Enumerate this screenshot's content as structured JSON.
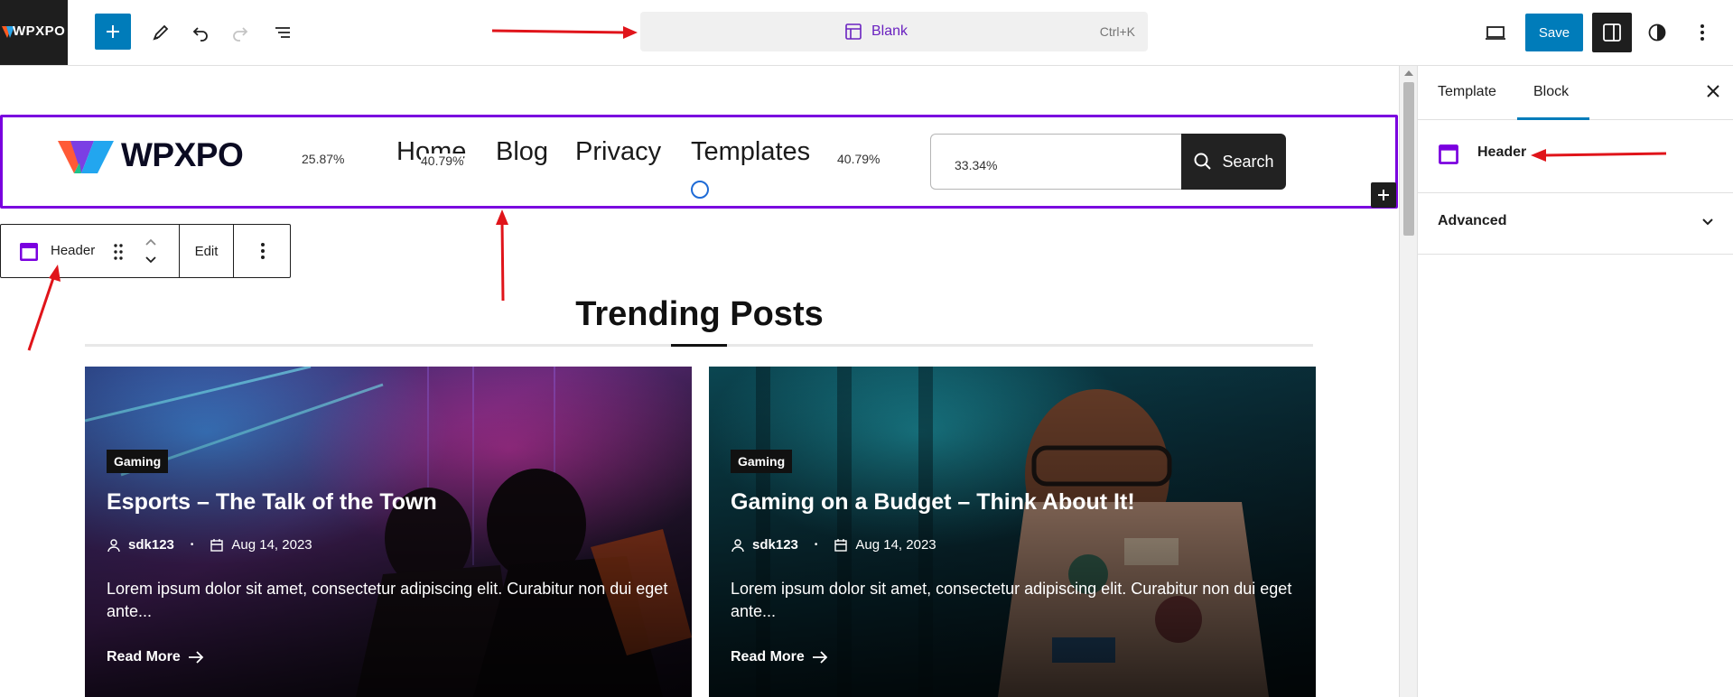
{
  "app": {
    "logo_text": "WPXPO"
  },
  "toolbar": {
    "document_title": "Blank",
    "shortcut": "Ctrl+K",
    "save_label": "Save"
  },
  "header_block": {
    "site_name": "WPXPO",
    "nav_items": [
      "Home",
      "Blog",
      "Privacy",
      "Templates"
    ],
    "width_labels": [
      "25.87%",
      "40.79%",
      "40.79%",
      "33.34%"
    ],
    "search_label": "Search"
  },
  "block_toolbar": {
    "block_name": "Header",
    "edit_label": "Edit"
  },
  "section": {
    "title": "Trending Posts"
  },
  "posts": [
    {
      "category": "Gaming",
      "title": "Esports – The Talk of the Town",
      "author": "sdk123",
      "date": "Aug 14, 2023",
      "excerpt": "Lorem ipsum dolor sit amet, consectetur adipiscing elit. Curabitur non dui eget ante...",
      "read_more": "Read More"
    },
    {
      "category": "Gaming",
      "title": "Gaming on a Budget – Think About It!",
      "author": "sdk123",
      "date": "Aug 14, 2023",
      "excerpt": "Lorem ipsum dolor sit amet, consectetur adipiscing elit. Curabitur non dui eget ante...",
      "read_more": "Read More"
    }
  ],
  "sidebar": {
    "tabs": [
      "Template",
      "Block"
    ],
    "active_tab": "Block",
    "block_name": "Header",
    "panel": "Advanced"
  },
  "colors": {
    "accent_blue": "#007cba",
    "block_purple": "#7a00df",
    "annotation_red": "#e0141a"
  }
}
